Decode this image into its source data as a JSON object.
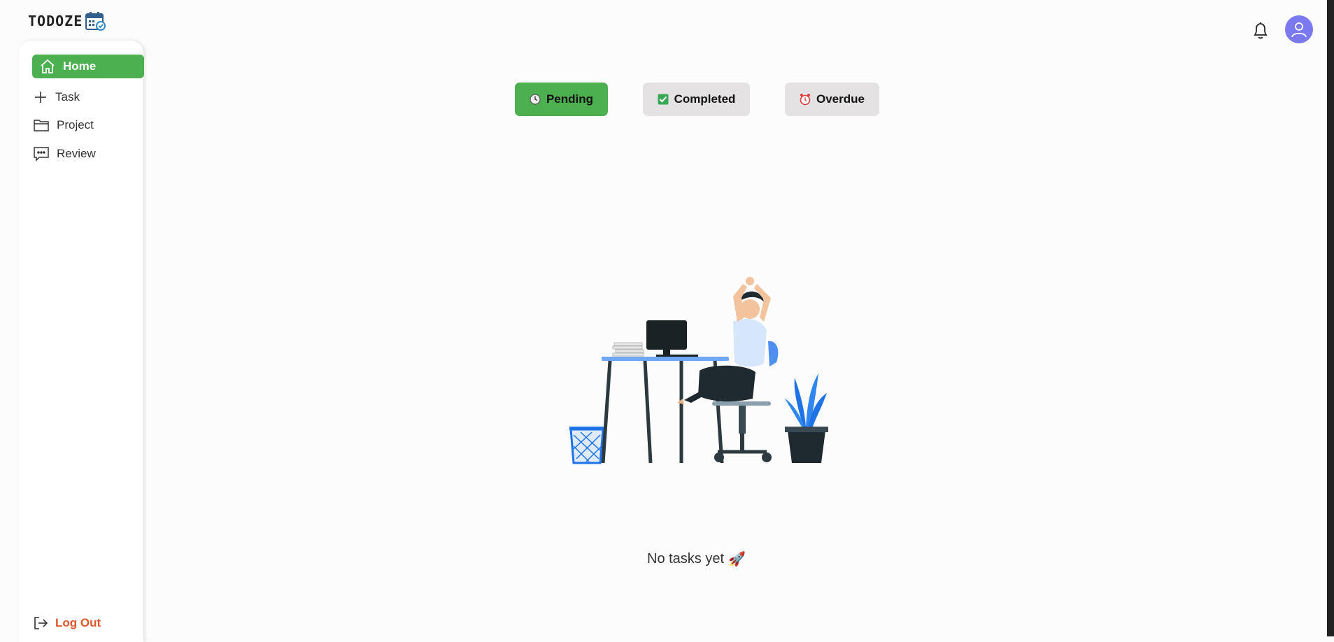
{
  "app": {
    "name": "TODOZE"
  },
  "sidebar": {
    "items": [
      {
        "label": "Home",
        "icon": "home-icon",
        "active": true
      },
      {
        "label": "Task",
        "icon": "plus-icon",
        "active": false
      },
      {
        "label": "Project",
        "icon": "folder-icon",
        "active": false
      },
      {
        "label": "Review",
        "icon": "chat-icon",
        "active": false
      }
    ],
    "logout_label": "Log Out"
  },
  "tabs": [
    {
      "label": "Pending",
      "icon": "clock-icon",
      "active": true
    },
    {
      "label": "Completed",
      "icon": "check-box-icon",
      "active": false
    },
    {
      "label": "Overdue",
      "icon": "alarm-clock-icon",
      "active": false
    }
  ],
  "empty_state": {
    "message": "No tasks yet",
    "emoji": "🚀"
  },
  "colors": {
    "accent": "#4caf50",
    "logout": "#e0572b",
    "avatar": "#7b79f0",
    "tab_inactive": "#e4e2e2"
  }
}
